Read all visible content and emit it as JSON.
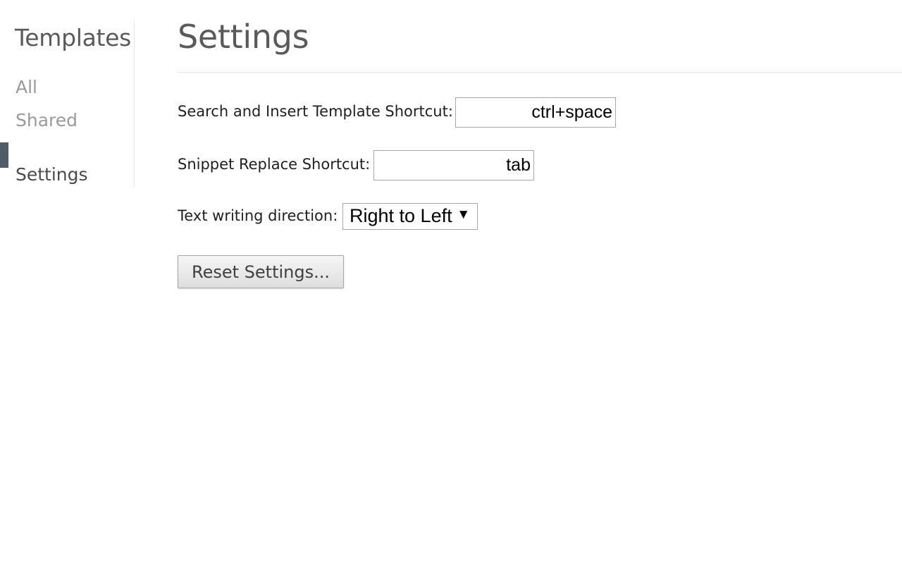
{
  "sidebar": {
    "title": "Templates",
    "items": [
      {
        "label": "All"
      },
      {
        "label": "Shared"
      },
      {
        "label": "Settings"
      }
    ],
    "active_item": "Settings",
    "active_color": "#4f5b66"
  },
  "main": {
    "title": "Settings",
    "settings": {
      "search_insert": {
        "label": "Search and Insert Template Shortcut:",
        "value": "ctrl+space"
      },
      "snippet_replace": {
        "label": "Snippet Replace Shortcut:",
        "value": "tab"
      },
      "text_direction": {
        "label": "Text writing direction:",
        "selected": "Right to Left",
        "arrow_icon": "triangle-down"
      }
    },
    "reset_button_label": "Reset Settings..."
  }
}
